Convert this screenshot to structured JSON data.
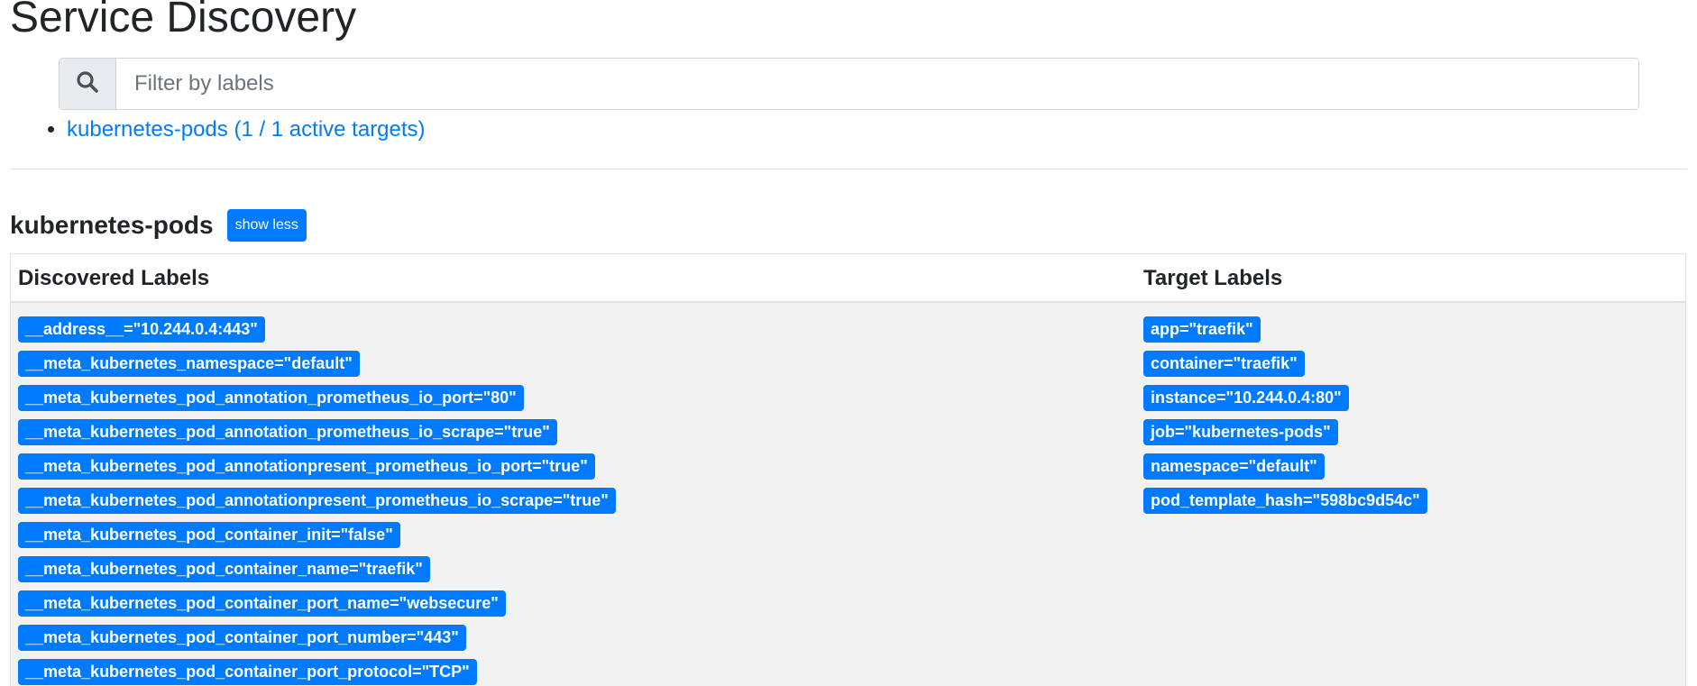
{
  "page": {
    "title": "Service Discovery"
  },
  "search": {
    "placeholder": "Filter by labels",
    "value": "",
    "icon": "search-icon"
  },
  "job_links": [
    {
      "label": "kubernetes-pods (1 / 1 active targets)"
    }
  ],
  "section": {
    "title": "kubernetes-pods",
    "toggle_label": "show less",
    "columns": {
      "discovered": "Discovered Labels",
      "target": "Target Labels"
    },
    "discovered_labels": [
      "__address__=\"10.244.0.4:443\"",
      "__meta_kubernetes_namespace=\"default\"",
      "__meta_kubernetes_pod_annotation_prometheus_io_port=\"80\"",
      "__meta_kubernetes_pod_annotation_prometheus_io_scrape=\"true\"",
      "__meta_kubernetes_pod_annotationpresent_prometheus_io_port=\"true\"",
      "__meta_kubernetes_pod_annotationpresent_prometheus_io_scrape=\"true\"",
      "__meta_kubernetes_pod_container_init=\"false\"",
      "__meta_kubernetes_pod_container_name=\"traefik\"",
      "__meta_kubernetes_pod_container_port_name=\"websecure\"",
      "__meta_kubernetes_pod_container_port_number=\"443\"",
      "__meta_kubernetes_pod_container_port_protocol=\"TCP\""
    ],
    "target_labels": [
      "app=\"traefik\"",
      "container=\"traefik\"",
      "instance=\"10.244.0.4:80\"",
      "job=\"kubernetes-pods\"",
      "namespace=\"default\"",
      "pod_template_hash=\"598bc9d54c\""
    ]
  },
  "colors": {
    "accent": "#007bff",
    "text": "#212529",
    "table_body_bg": "#f2f2f2",
    "border": "#dee2e6"
  }
}
